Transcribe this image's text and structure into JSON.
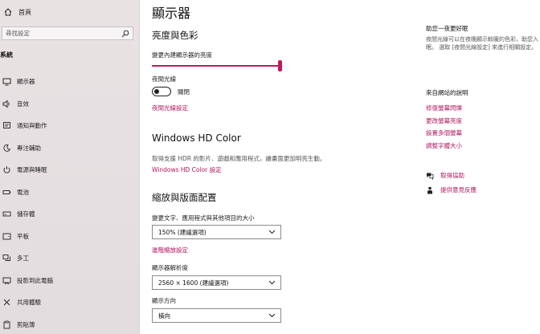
{
  "sidebar": {
    "home_label": "首頁",
    "search_placeholder": "尋找設定",
    "section_heading": "系統",
    "items": [
      {
        "label": "顯示器",
        "icon": "monitor-icon"
      },
      {
        "label": "音效",
        "icon": "speaker-icon"
      },
      {
        "label": "通知與動作",
        "icon": "notification-icon"
      },
      {
        "label": "專注輔助",
        "icon": "moon-icon"
      },
      {
        "label": "電源與睡眠",
        "icon": "power-icon"
      },
      {
        "label": "電池",
        "icon": "battery-icon"
      },
      {
        "label": "儲存體",
        "icon": "storage-icon"
      },
      {
        "label": "平板",
        "icon": "tablet-icon"
      },
      {
        "label": "多工",
        "icon": "multitask-icon"
      },
      {
        "label": "投影到此電腦",
        "icon": "project-icon"
      },
      {
        "label": "共用體驗",
        "icon": "shared-icon"
      },
      {
        "label": "剪貼簿",
        "icon": "clipboard-icon"
      }
    ]
  },
  "main": {
    "page_title": "顯示器",
    "brightness": {
      "heading": "亮度與色彩",
      "slider_label": "變更內建顯示器的亮度",
      "slider_value": 1.0
    },
    "night_light": {
      "label": "夜間光線",
      "state_label": "關閉",
      "is_on": false,
      "settings_link": "夜間光線設定"
    },
    "hdr": {
      "heading": "Windows HD Color",
      "description": "取得支援 HDR 的影片、遊戲和應用程式，讓畫面更加明亮生動。",
      "settings_link": "Windows HD Color 設定"
    },
    "scale_layout": {
      "heading": "縮放與版面配置",
      "scale_label": "變更文字、應用程式與其他項目的大小",
      "scale_value": "150% (建議選項)",
      "advanced_link": "進階縮放設定",
      "resolution_label": "顯示器解析度",
      "resolution_value": "2560 × 1600 (建議選項)",
      "orientation_label": "顯示方向",
      "orientation_value": "橫向"
    }
  },
  "right": {
    "tip_heading": "助您一夜更好眠",
    "tip_text": "夜間光線可以在夜晚顯示較暖的色彩，助您入眠。 選取 [夜間光線設定] 來進行相關設定。",
    "web_help_heading": "來自網站的說明",
    "web_links": [
      "修復螢幕閃爍",
      "更改螢幕亮度",
      "設置多個螢幕",
      "調整字體大小"
    ],
    "get_help": "取得協助",
    "feedback": "提供意見反應"
  },
  "colors": {
    "accent": "#c3185a",
    "link": "#b3135e",
    "sidebar_bg": "#e7e1e2"
  }
}
